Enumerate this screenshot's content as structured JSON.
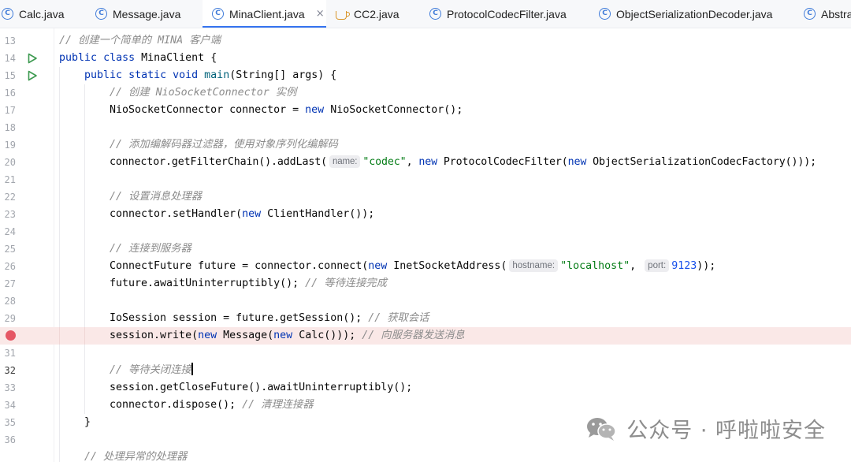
{
  "tabs": [
    {
      "label": "Calc.java",
      "icon": "class-icon",
      "active": false
    },
    {
      "label": "Message.java",
      "icon": "class-icon",
      "active": false
    },
    {
      "label": "MinaClient.java",
      "icon": "class-icon",
      "active": true,
      "close": "×"
    },
    {
      "label": "CC2.java",
      "icon": "java-cup-icon",
      "active": false
    },
    {
      "label": "ProtocolCodecFilter.java",
      "icon": "class-icon",
      "active": false
    },
    {
      "label": "ObjectSerializationDecoder.java",
      "icon": "class-icon",
      "active": false
    },
    {
      "label": "Abstra",
      "icon": "class-icon",
      "active": false
    }
  ],
  "tab_icon_letter": "C",
  "lines": [
    {
      "num": "13",
      "text": "// 创建一个简单的 MINA 客户端"
    },
    {
      "num": "14",
      "text": "public class MinaClient {",
      "gutter": "run-icon"
    },
    {
      "num": "15",
      "text": "public static void main(String[] args) {",
      "gutter": "run-icon"
    },
    {
      "num": "16",
      "text": "// 创建 NioSocketConnector 实例"
    },
    {
      "num": "17",
      "text": "NioSocketConnector connector = new NioSocketConnector();"
    },
    {
      "num": "18",
      "text": ""
    },
    {
      "num": "19",
      "text": "// 添加编解码器过滤器，使用对象序列化编解码"
    },
    {
      "num": "20",
      "text": "connector.getFilterChain().addLast( name: \"codec\", new ProtocolCodecFilter(new ObjectSerializationCodecFactory()));"
    },
    {
      "num": "21",
      "text": ""
    },
    {
      "num": "22",
      "text": "// 设置消息处理器"
    },
    {
      "num": "23",
      "text": "connector.setHandler(new ClientHandler());"
    },
    {
      "num": "24",
      "text": ""
    },
    {
      "num": "25",
      "text": "// 连接到服务器"
    },
    {
      "num": "26",
      "text": "ConnectFuture future = connector.connect(new InetSocketAddress( hostname: \"localhost\",  port: 9123));"
    },
    {
      "num": "27",
      "text": "future.awaitUninterruptibly(); // 等待连接完成"
    },
    {
      "num": "28",
      "text": ""
    },
    {
      "num": "29",
      "text": "IoSession session = future.getSession(); // 获取会话"
    },
    {
      "num": "",
      "text": "session.write(new Message(new Calc())); // 向服务器发送消息",
      "gutter": "breakpoint-icon"
    },
    {
      "num": "31",
      "text": ""
    },
    {
      "num": "32",
      "text": "// 等待关闭连接"
    },
    {
      "num": "33",
      "text": "session.getCloseFuture().awaitUninterruptibly();"
    },
    {
      "num": "34",
      "text": "connector.dispose(); // 清理连接器"
    },
    {
      "num": "35",
      "text": "}"
    },
    {
      "num": "36",
      "text": ""
    },
    {
      "num": "",
      "text": "// 处理异常的处理器"
    }
  ],
  "tokens": {
    "l13c": "// 创建一个简单的 MINA 客户端",
    "public": "public",
    "class": "class",
    "MinaClient": "MinaClient",
    "brace": "{",
    "static": "static",
    "void": "void",
    "main": "main",
    "mainArgs": "(String[] args) {",
    "l16c": "// 创建 NioSocketConnector 实例",
    "l17a": "NioSocketConnector connector = ",
    "new": "new",
    "l17b": " NioSocketConnector();",
    "l19c": "// 添加编解码器过滤器，使用对象序列化编解码",
    "l20a": "connector.getFilterChain().addLast(",
    "hint_name": "name:",
    "codec": "\"codec\"",
    "comma": ", ",
    "l20b": " ProtocolCodecFilter(",
    "l20c": " ObjectSerializationCodecFactory()));",
    "l22c": "// 设置消息处理器",
    "l23a": "connector.setHandler(",
    "l23b": " ClientHandler());",
    "l25c": "// 连接到服务器",
    "l26a": "ConnectFuture future = connector.connect(",
    "l26b": " InetSocketAddress(",
    "hint_hostname": "hostname:",
    "localhost": "\"localhost\"",
    "comma2": ",",
    "hint_port": "port:",
    "port": "9123",
    "l26c": "));",
    "l27a": "future.awaitUninterruptibly(); ",
    "l27c": "// 等待连接完成",
    "l29a": "IoSession session = future.getSession(); ",
    "l29c": "// 获取会话",
    "l30a": "session.write(",
    "l30b": " Message(",
    "l30d": " Calc())); ",
    "l30c": "// 向服务器发送消息",
    "l32c": "// 等待关闭连接",
    "l33a": "session.getCloseFuture().awaitUninterruptibly();",
    "l34a": "connector.dispose(); ",
    "l34c": "// 清理连接器",
    "closeBrace": "}",
    "l37c": "// 处理异常的处理器"
  },
  "watermark": {
    "text": "公众号 · 呼啦啦安全"
  },
  "colors": {
    "keyword": "#0033b3",
    "string": "#067d17",
    "number": "#1750eb",
    "comment": "#8c8c8c",
    "breakpoint": "#e55765",
    "run": "#3d9a50",
    "accent": "#3574f0"
  }
}
